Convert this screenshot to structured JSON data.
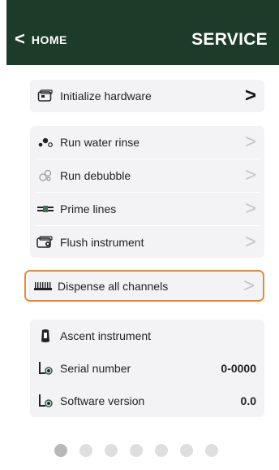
{
  "header": {
    "back_label": "HOME",
    "title": "SERVICE"
  },
  "colors": {
    "header_bg": "#1d3b29",
    "accent_border": "#e08a45"
  },
  "group1": [
    {
      "label": "Initialize hardware",
      "icon": "hardware-icon"
    }
  ],
  "group2": [
    {
      "label": "Run water rinse",
      "icon": "water-drops-icon"
    },
    {
      "label": "Run debubble",
      "icon": "bubbles-icon"
    },
    {
      "label": "Prime lines",
      "icon": "lines-icon"
    },
    {
      "label": "Flush instrument",
      "icon": "flush-icon"
    }
  ],
  "group3": [
    {
      "label": "Dispense all channels",
      "icon": "channels-icon"
    }
  ],
  "info": {
    "instrument_label": "Ascent instrument",
    "serial_label": "Serial number",
    "serial_value": "0-0000",
    "software_label": "Software version",
    "software_value": "0.0"
  },
  "pagination": {
    "pages": 7,
    "current": 1
  }
}
